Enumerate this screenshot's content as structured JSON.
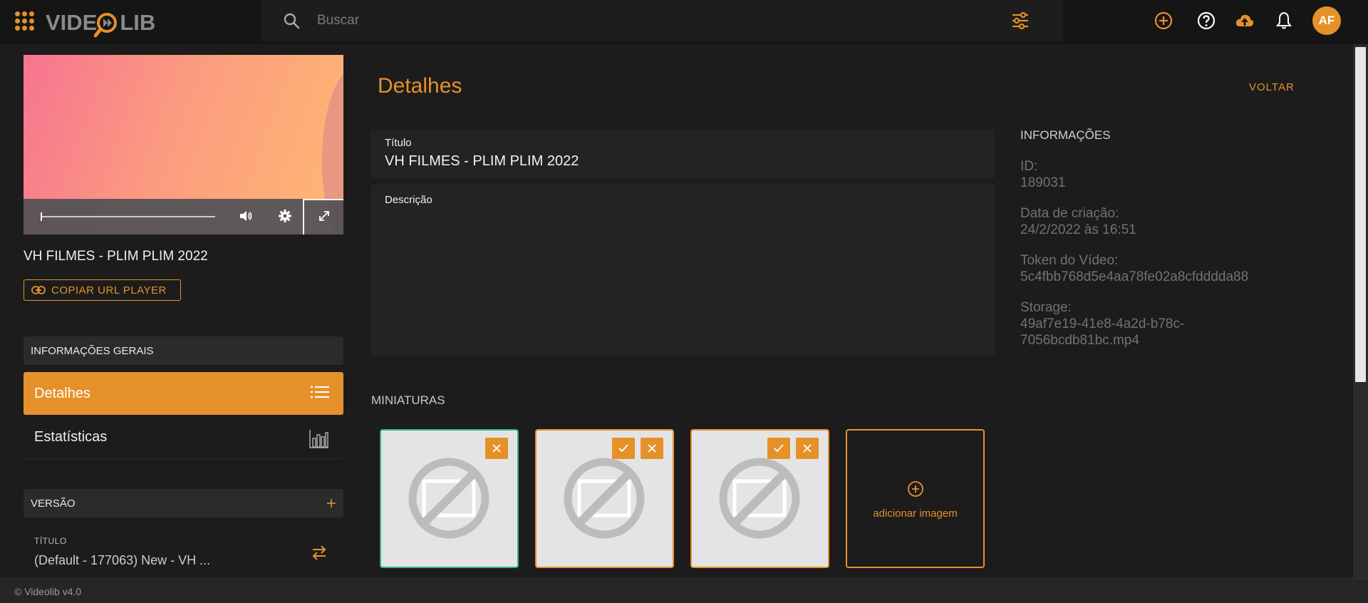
{
  "app": {
    "logo_left": "VIDE",
    "logo_right": "LIB"
  },
  "search": {
    "placeholder": "Buscar"
  },
  "user": {
    "initials": "AF"
  },
  "video": {
    "title": "VH FILMES - PLIM PLIM 2022",
    "progress_fraction": 0.0
  },
  "copy_button": {
    "label": "COPIAR URL PLAYER"
  },
  "sidebar": {
    "general_header": "INFORMAÇÕES GERAIS",
    "items": [
      {
        "label": "Detalhes",
        "icon": "list-icon",
        "active": true
      },
      {
        "label": "Estatísticas",
        "icon": "bar-chart-icon",
        "active": false
      }
    ],
    "version_header": "VERSÃO",
    "version_field_label": "TÍTULO",
    "version_field_value": "(Default - 177063) New - VH ..."
  },
  "main": {
    "title": "Detalhes",
    "back_label": "VOLTAR",
    "title_field": {
      "label": "Título",
      "value": "VH FILMES - PLIM PLIM 2022"
    },
    "description_field": {
      "label": "Descrição",
      "value": ""
    },
    "thumbnails_title": "MINIATURAS",
    "add_image_label": "adicionar imagem"
  },
  "info": {
    "title": "INFORMAÇÕES",
    "id_label": "ID:",
    "id_value": "189031",
    "created_label": "Data de criação:",
    "created_value": "24/2/2022 às 16:51",
    "token_label": "Token do Vídeo:",
    "token_value": "5c4fbb768d5e4aa78fe02a8cfdddda88",
    "storage_label": "Storage:",
    "storage_value_line1": "49af7e19-41e8-4a2d-b78c-",
    "storage_value_line2": "7056bcdb81bc.mp4"
  },
  "footer": {
    "text": "© Videolib v4.0"
  },
  "colors": {
    "accent": "#e5912a",
    "selected": "#2eb872",
    "background": "#1c1c1c"
  }
}
